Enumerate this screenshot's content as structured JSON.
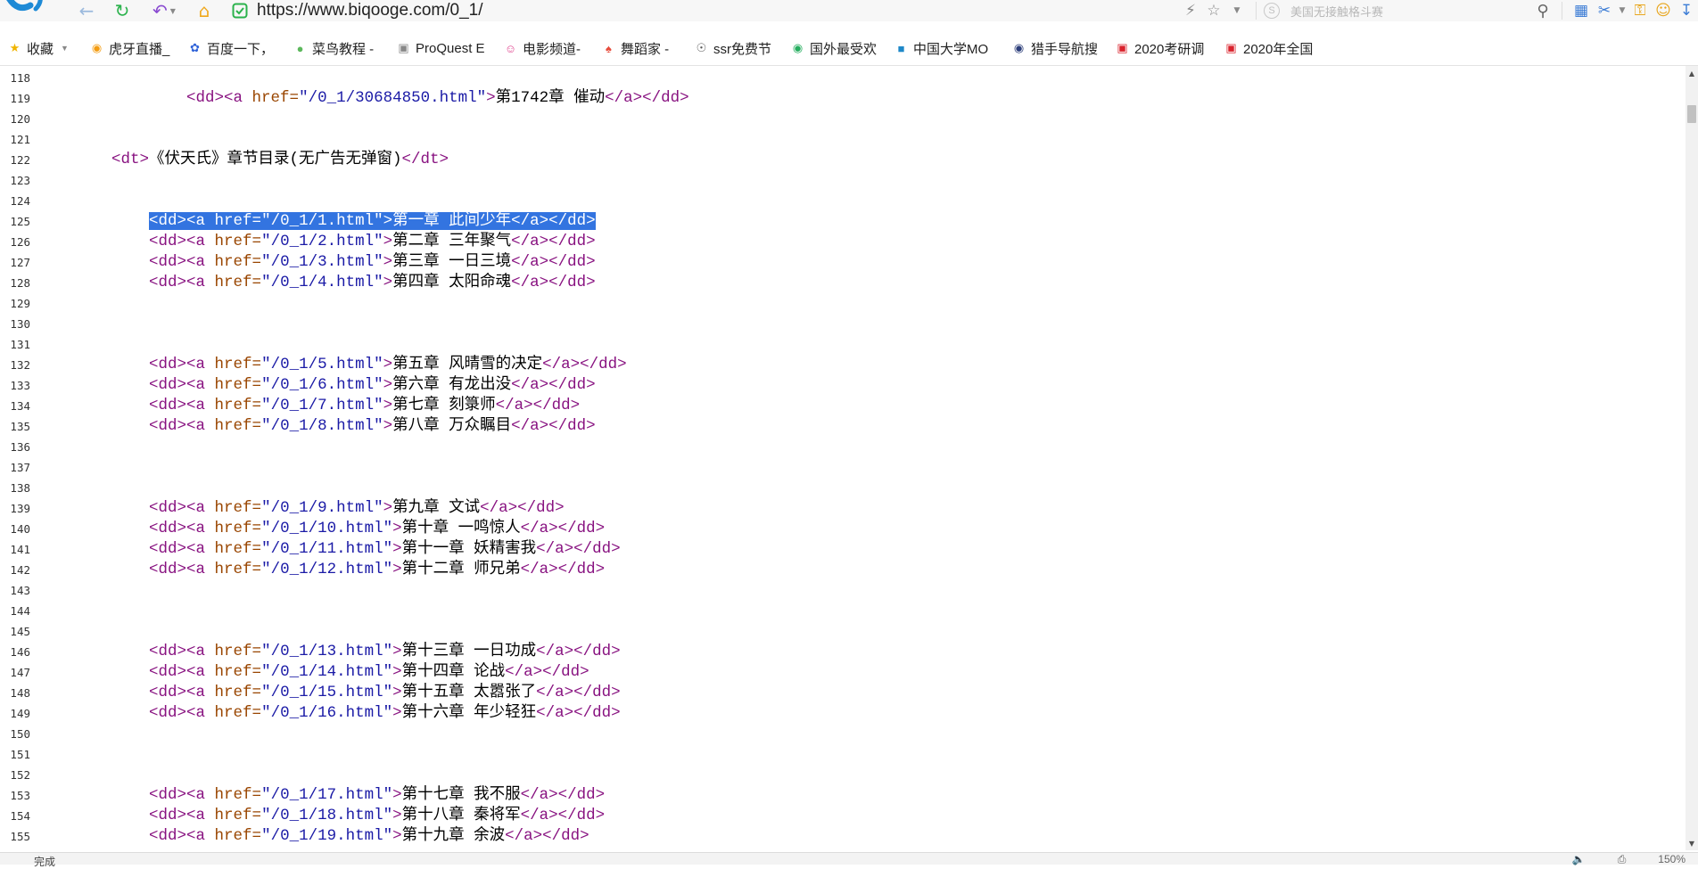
{
  "browser": {
    "url": "https://www.biqooge.com/0_1/",
    "search_placeholder": "美国无接触格斗赛",
    "accent": "#1e8ad6"
  },
  "bookmarks": [
    {
      "label": "收藏",
      "icon": "star-icon",
      "caret": true
    },
    {
      "label": "虎牙直播_",
      "icon": "huya-icon"
    },
    {
      "label": "百度一下，",
      "icon": "baidu-paw-icon"
    },
    {
      "label": "菜鸟教程 -",
      "icon": "runoob-icon"
    },
    {
      "label": "ProQuest E",
      "icon": "document-icon"
    },
    {
      "label": "电影频道-",
      "icon": "smiley-icon"
    },
    {
      "label": "舞蹈家 -",
      "icon": "dancer-icon"
    },
    {
      "label": "ssr免费节",
      "icon": "bot-icon"
    },
    {
      "label": "国外最受欢",
      "icon": "leaf-icon"
    },
    {
      "label": "中国大学MO",
      "icon": "book-icon"
    },
    {
      "label": "猎手导航搜",
      "icon": "hunter-icon"
    },
    {
      "label": "2020考研调",
      "icon": "red-square-icon"
    },
    {
      "label": "2020年全国",
      "icon": "red-square-icon"
    }
  ],
  "source": {
    "lines": [
      {
        "n": "118",
        "indent": "",
        "parts": []
      },
      {
        "n": "119",
        "indent": "                ",
        "parts": [
          [
            "tag",
            "<dd><a "
          ],
          [
            "attr",
            "href="
          ],
          [
            "val",
            "\"/0_1/30684850.html\""
          ],
          [
            "tag",
            ">"
          ],
          [
            "txt",
            "第1742章 催动"
          ],
          [
            "tag",
            "</a></dd>"
          ]
        ]
      },
      {
        "n": "120",
        "indent": "",
        "parts": []
      },
      {
        "n": "121",
        "indent": "",
        "parts": []
      },
      {
        "n": "122",
        "indent": "        ",
        "parts": [
          [
            "tag",
            "<dt>"
          ],
          [
            "txt",
            "《伏天氏》章节目录(无广告无弹窗)"
          ],
          [
            "tag",
            "</dt>"
          ]
        ]
      },
      {
        "n": "123",
        "indent": "",
        "parts": []
      },
      {
        "n": "124",
        "indent": "",
        "parts": []
      },
      {
        "n": "125",
        "indent": "            ",
        "selected": true,
        "parts": [
          [
            "tag",
            "<dd><a "
          ],
          [
            "attr",
            "href="
          ],
          [
            "val",
            "\"/0_1/1.html\""
          ],
          [
            "tag",
            ">"
          ],
          [
            "txt",
            "第一章 此间少年"
          ],
          [
            "tag",
            "</a></dd>"
          ]
        ]
      },
      {
        "n": "126",
        "indent": "            ",
        "parts": [
          [
            "tag",
            "<dd><a "
          ],
          [
            "attr",
            "href="
          ],
          [
            "val",
            "\"/0_1/2.html\""
          ],
          [
            "tag",
            ">"
          ],
          [
            "txt",
            "第二章 三年聚气"
          ],
          [
            "tag",
            "</a></dd>"
          ]
        ]
      },
      {
        "n": "127",
        "indent": "            ",
        "parts": [
          [
            "tag",
            "<dd><a "
          ],
          [
            "attr",
            "href="
          ],
          [
            "val",
            "\"/0_1/3.html\""
          ],
          [
            "tag",
            ">"
          ],
          [
            "txt",
            "第三章 一日三境"
          ],
          [
            "tag",
            "</a></dd>"
          ]
        ]
      },
      {
        "n": "128",
        "indent": "            ",
        "parts": [
          [
            "tag",
            "<dd><a "
          ],
          [
            "attr",
            "href="
          ],
          [
            "val",
            "\"/0_1/4.html\""
          ],
          [
            "tag",
            ">"
          ],
          [
            "txt",
            "第四章 太阳命魂"
          ],
          [
            "tag",
            "</a></dd>"
          ]
        ]
      },
      {
        "n": "129",
        "indent": "",
        "parts": []
      },
      {
        "n": "130",
        "indent": "",
        "parts": []
      },
      {
        "n": "131",
        "indent": "",
        "parts": []
      },
      {
        "n": "132",
        "indent": "            ",
        "parts": [
          [
            "tag",
            "<dd><a "
          ],
          [
            "attr",
            "href="
          ],
          [
            "val",
            "\"/0_1/5.html\""
          ],
          [
            "tag",
            ">"
          ],
          [
            "txt",
            "第五章 风晴雪的决定"
          ],
          [
            "tag",
            "</a></dd>"
          ]
        ]
      },
      {
        "n": "133",
        "indent": "            ",
        "parts": [
          [
            "tag",
            "<dd><a "
          ],
          [
            "attr",
            "href="
          ],
          [
            "val",
            "\"/0_1/6.html\""
          ],
          [
            "tag",
            ">"
          ],
          [
            "txt",
            "第六章 有龙出没"
          ],
          [
            "tag",
            "</a></dd>"
          ]
        ]
      },
      {
        "n": "134",
        "indent": "            ",
        "parts": [
          [
            "tag",
            "<dd><a "
          ],
          [
            "attr",
            "href="
          ],
          [
            "val",
            "\"/0_1/7.html\""
          ],
          [
            "tag",
            ">"
          ],
          [
            "txt",
            "第七章 刻箓师"
          ],
          [
            "tag",
            "</a></dd>"
          ]
        ]
      },
      {
        "n": "135",
        "indent": "            ",
        "parts": [
          [
            "tag",
            "<dd><a "
          ],
          [
            "attr",
            "href="
          ],
          [
            "val",
            "\"/0_1/8.html\""
          ],
          [
            "tag",
            ">"
          ],
          [
            "txt",
            "第八章 万众瞩目"
          ],
          [
            "tag",
            "</a></dd>"
          ]
        ]
      },
      {
        "n": "136",
        "indent": "",
        "parts": []
      },
      {
        "n": "137",
        "indent": "",
        "parts": []
      },
      {
        "n": "138",
        "indent": "",
        "parts": []
      },
      {
        "n": "139",
        "indent": "            ",
        "parts": [
          [
            "tag",
            "<dd><a "
          ],
          [
            "attr",
            "href="
          ],
          [
            "val",
            "\"/0_1/9.html\""
          ],
          [
            "tag",
            ">"
          ],
          [
            "txt",
            "第九章 文试"
          ],
          [
            "tag",
            "</a></dd>"
          ]
        ]
      },
      {
        "n": "140",
        "indent": "            ",
        "parts": [
          [
            "tag",
            "<dd><a "
          ],
          [
            "attr",
            "href="
          ],
          [
            "val",
            "\"/0_1/10.html\""
          ],
          [
            "tag",
            ">"
          ],
          [
            "txt",
            "第十章 一鸣惊人"
          ],
          [
            "tag",
            "</a></dd>"
          ]
        ]
      },
      {
        "n": "141",
        "indent": "            ",
        "parts": [
          [
            "tag",
            "<dd><a "
          ],
          [
            "attr",
            "href="
          ],
          [
            "val",
            "\"/0_1/11.html\""
          ],
          [
            "tag",
            ">"
          ],
          [
            "txt",
            "第十一章 妖精害我"
          ],
          [
            "tag",
            "</a></dd>"
          ]
        ]
      },
      {
        "n": "142",
        "indent": "            ",
        "parts": [
          [
            "tag",
            "<dd><a "
          ],
          [
            "attr",
            "href="
          ],
          [
            "val",
            "\"/0_1/12.html\""
          ],
          [
            "tag",
            ">"
          ],
          [
            "txt",
            "第十二章 师兄弟"
          ],
          [
            "tag",
            "</a></dd>"
          ]
        ]
      },
      {
        "n": "143",
        "indent": "",
        "parts": []
      },
      {
        "n": "144",
        "indent": "",
        "parts": []
      },
      {
        "n": "145",
        "indent": "",
        "parts": []
      },
      {
        "n": "146",
        "indent": "            ",
        "parts": [
          [
            "tag",
            "<dd><a "
          ],
          [
            "attr",
            "href="
          ],
          [
            "val",
            "\"/0_1/13.html\""
          ],
          [
            "tag",
            ">"
          ],
          [
            "txt",
            "第十三章 一日功成"
          ],
          [
            "tag",
            "</a></dd>"
          ]
        ]
      },
      {
        "n": "147",
        "indent": "            ",
        "parts": [
          [
            "tag",
            "<dd><a "
          ],
          [
            "attr",
            "href="
          ],
          [
            "val",
            "\"/0_1/14.html\""
          ],
          [
            "tag",
            ">"
          ],
          [
            "txt",
            "第十四章 论战"
          ],
          [
            "tag",
            "</a></dd>"
          ]
        ]
      },
      {
        "n": "148",
        "indent": "            ",
        "parts": [
          [
            "tag",
            "<dd><a "
          ],
          [
            "attr",
            "href="
          ],
          [
            "val",
            "\"/0_1/15.html\""
          ],
          [
            "tag",
            ">"
          ],
          [
            "txt",
            "第十五章 太嚣张了"
          ],
          [
            "tag",
            "</a></dd>"
          ]
        ]
      },
      {
        "n": "149",
        "indent": "            ",
        "parts": [
          [
            "tag",
            "<dd><a "
          ],
          [
            "attr",
            "href="
          ],
          [
            "val",
            "\"/0_1/16.html\""
          ],
          [
            "tag",
            ">"
          ],
          [
            "txt",
            "第十六章 年少轻狂"
          ],
          [
            "tag",
            "</a></dd>"
          ]
        ]
      },
      {
        "n": "150",
        "indent": "",
        "parts": []
      },
      {
        "n": "151",
        "indent": "",
        "parts": []
      },
      {
        "n": "152",
        "indent": "",
        "parts": []
      },
      {
        "n": "153",
        "indent": "            ",
        "parts": [
          [
            "tag",
            "<dd><a "
          ],
          [
            "attr",
            "href="
          ],
          [
            "val",
            "\"/0_1/17.html\""
          ],
          [
            "tag",
            ">"
          ],
          [
            "txt",
            "第十七章 我不服"
          ],
          [
            "tag",
            "</a></dd>"
          ]
        ]
      },
      {
        "n": "154",
        "indent": "            ",
        "parts": [
          [
            "tag",
            "<dd><a "
          ],
          [
            "attr",
            "href="
          ],
          [
            "val",
            "\"/0_1/18.html\""
          ],
          [
            "tag",
            ">"
          ],
          [
            "txt",
            "第十八章 秦将军"
          ],
          [
            "tag",
            "</a></dd>"
          ]
        ]
      },
      {
        "n": "155",
        "indent": "            ",
        "parts": [
          [
            "tag",
            "<dd><a "
          ],
          [
            "attr",
            "href="
          ],
          [
            "val",
            "\"/0_1/19.html\""
          ],
          [
            "tag",
            ">"
          ],
          [
            "txt",
            "第十九章 余波"
          ],
          [
            "tag",
            "</a></dd>"
          ]
        ]
      }
    ]
  },
  "scroll_position": 0.0,
  "status": {
    "text": "完成",
    "zoom": "150%"
  }
}
